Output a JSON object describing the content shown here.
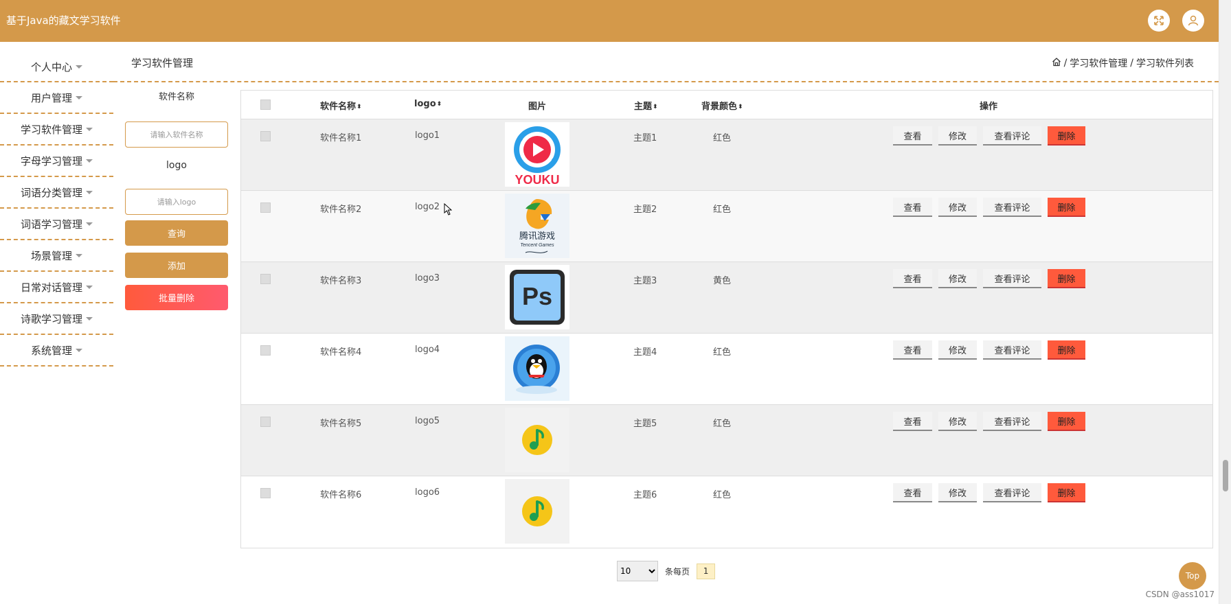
{
  "app": {
    "title": "基于Java的藏文学习软件"
  },
  "header_icons": {
    "fullscreen": "fullscreen-icon",
    "user": "user-icon"
  },
  "sidebar": {
    "items": [
      {
        "label": "个人中心"
      },
      {
        "label": "用户管理"
      },
      {
        "label": "学习软件管理"
      },
      {
        "label": "字母学习管理"
      },
      {
        "label": "词语分类管理"
      },
      {
        "label": "词语学习管理"
      },
      {
        "label": "场景管理"
      },
      {
        "label": "日常对话管理"
      },
      {
        "label": "诗歌学习管理"
      },
      {
        "label": "系统管理"
      }
    ]
  },
  "page": {
    "title": "学习软件管理",
    "breadcrumb": [
      "学习软件管理",
      "学习软件列表"
    ],
    "breadcrumb_sep": "/"
  },
  "search": {
    "name_label": "软件名称",
    "name_placeholder": "请输入软件名称",
    "logo_label": "logo",
    "logo_placeholder": "请输入logo",
    "query_label": "查询",
    "add_label": "添加",
    "batch_delete_label": "批量删除"
  },
  "table": {
    "headers": {
      "name": "软件名称",
      "logo": "logo",
      "image": "图片",
      "theme": "主题",
      "bgcolor": "背景颜色",
      "actions": "操作"
    },
    "rows": [
      {
        "name": "软件名称1",
        "logo": "logo1",
        "theme": "主题1",
        "bgcolor": "红色",
        "image": "youku"
      },
      {
        "name": "软件名称2",
        "logo": "logo2",
        "theme": "主题2",
        "bgcolor": "红色",
        "image": "tencent-games"
      },
      {
        "name": "软件名称3",
        "logo": "logo3",
        "theme": "主题3",
        "bgcolor": "黄色",
        "image": "photoshop"
      },
      {
        "name": "软件名称4",
        "logo": "logo4",
        "theme": "主题4",
        "bgcolor": "红色",
        "image": "qq-penguin"
      },
      {
        "name": "软件名称5",
        "logo": "logo5",
        "theme": "主题5",
        "bgcolor": "红色",
        "image": "qq-music"
      },
      {
        "name": "软件名称6",
        "logo": "logo6",
        "theme": "主题6",
        "bgcolor": "红色",
        "image": "qq-music"
      }
    ],
    "actions": {
      "view": "查看",
      "edit": "修改",
      "comments": "查看评论",
      "delete": "删除"
    }
  },
  "pager": {
    "page_size": "10",
    "per_page_label": "条每页",
    "current_page": "1"
  },
  "top_button": "Top",
  "watermark": "CSDN @ass1017",
  "image_text": {
    "youku": "YOUKU",
    "photoshop": "Ps",
    "tencent_line1": "腾讯游戏",
    "tencent_line2": "Tencent Games"
  },
  "colors": {
    "accent": "#d4994a",
    "danger": "#ff5a3c"
  }
}
